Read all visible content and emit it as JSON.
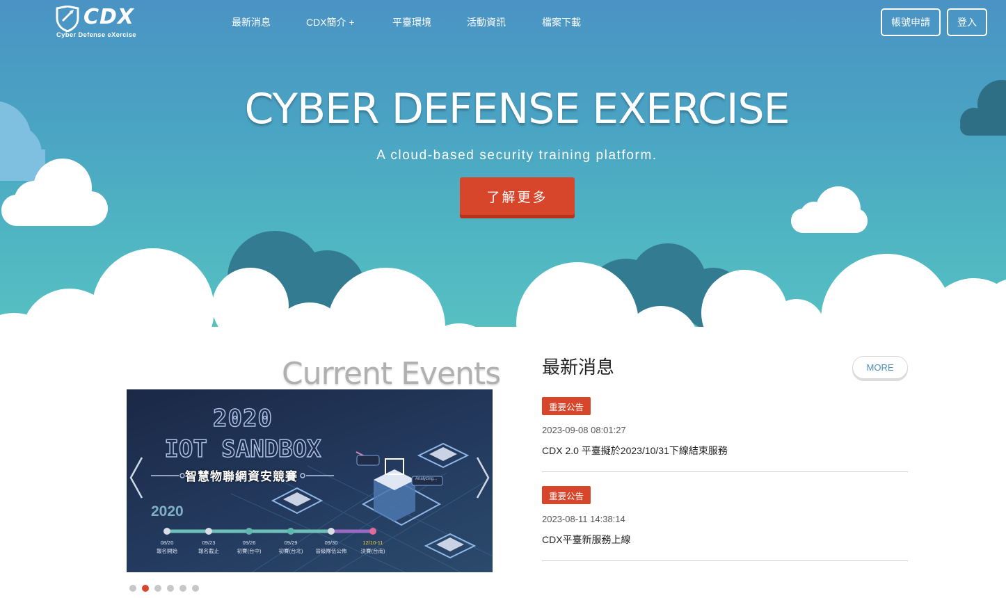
{
  "brand": {
    "name": "CDX",
    "tagline": "Cyber Defense eXercise"
  },
  "nav": {
    "items": [
      {
        "label": "最新消息"
      },
      {
        "label": "CDX簡介 +"
      },
      {
        "label": "平臺環境"
      },
      {
        "label": "活動資訊"
      },
      {
        "label": "檔案下載"
      }
    ],
    "register_label": "帳號申請",
    "login_label": "登入"
  },
  "hero": {
    "title": "CYBER DEFENSE EXERCISE",
    "subtitle": "A cloud-based security training platform.",
    "cta_label": "了解更多"
  },
  "events": {
    "title": "Current Events",
    "slide": {
      "year_title": "2020",
      "main_title": "IOT SANDBOX",
      "subtitle": "智慧物聯網資安競賽",
      "year_small": "2020",
      "tag": "Analyzing...",
      "timeline": [
        {
          "date": "08/20",
          "label": "報名開始"
        },
        {
          "date": "09/23",
          "label": "報名截止"
        },
        {
          "date": "09/26",
          "label": "初賽(台中)"
        },
        {
          "date": "09/29",
          "label": "初賽(台北)"
        },
        {
          "date": "09/30",
          "label": "晉級隊伍公佈"
        },
        {
          "date": "12/10-11",
          "label": "決賽(台南)"
        }
      ]
    },
    "dots_total": 6,
    "active_dot": 2
  },
  "news": {
    "title": "最新消息",
    "more_label": "MORE",
    "items": [
      {
        "badge": "重要公告",
        "date": "2023-09-08 08:01:27",
        "text": "CDX 2.0 平臺擬於2023/10/31下線結束服務"
      },
      {
        "badge": "重要公告",
        "date": "2023-08-11 14:38:14",
        "text": "CDX平臺新服務上線"
      }
    ]
  },
  "colors": {
    "accent": "#d7452a",
    "sky_top": "#4a93c4",
    "sky_bottom": "#57c2c2",
    "cloud_dark": "#327b91",
    "more_text": "#4c8fb5"
  }
}
